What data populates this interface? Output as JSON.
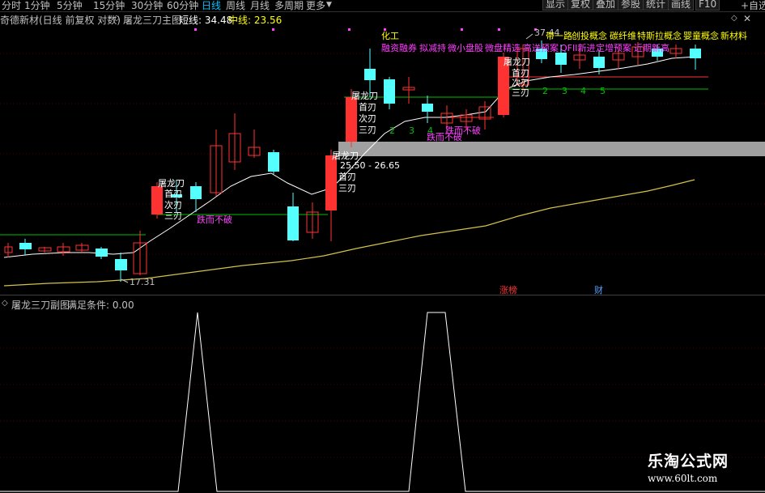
{
  "toolbar": {
    "periods": [
      "分时",
      "1分钟",
      "5分钟",
      "15分钟",
      "30分钟",
      "60分钟",
      "日线",
      "周线",
      "月线",
      "多周期",
      "更多"
    ],
    "active_period": "日线",
    "right_buttons": [
      "显示",
      "复权",
      "叠加",
      "参股",
      "统计",
      "画线",
      "F10"
    ],
    "right_extra": "+自选"
  },
  "title": {
    "stock": "奇德新材(日线 前复权 对数)",
    "indicator": "屠龙三刀主图",
    "short_line_label": "短线: 34.48",
    "mid_line_label": "中线: 23.56"
  },
  "chart": {
    "concepts_line1": [
      "化工",
      "带一路",
      "创投概念",
      "碳纤维",
      "特斯拉概念",
      "婴童概念",
      "新材料"
    ],
    "concepts_line2": [
      "融资融券",
      "拟减持",
      "微小盘股",
      "微盘精选",
      "高送预案",
      "QFII新进",
      "定增预案",
      "近期新高"
    ],
    "price_high_label": "37.44",
    "price_low_label": "17.31",
    "range_label": "25.50 - 26.65",
    "signal_labels": {
      "tu_long": "屠龙刀",
      "shou_ren": "首刃",
      "er_ren": "次刃",
      "san_ren": "三刃",
      "zhan_bu_po": "跌而不破"
    },
    "count_labels_a": [
      "2",
      "3",
      "4"
    ],
    "count_labels_b": [
      "2",
      "3",
      "4",
      "5"
    ],
    "markers": [
      "涨榜",
      "财"
    ],
    "colors": {
      "up": "#ff3232",
      "down": "#54ffff",
      "short_line": "#ffffff",
      "mid_line": "#d4c14a",
      "concept_yellow": "#ffff00",
      "concept_magenta": "#ff40ff",
      "signal_green": "#00c000"
    }
  },
  "sub_chart": {
    "title": "屠龙三刀副图",
    "condition_label": "满足条件: 0.00"
  },
  "watermark": {
    "brand": "乐淘公式网",
    "url": "www.60lt.com"
  }
}
